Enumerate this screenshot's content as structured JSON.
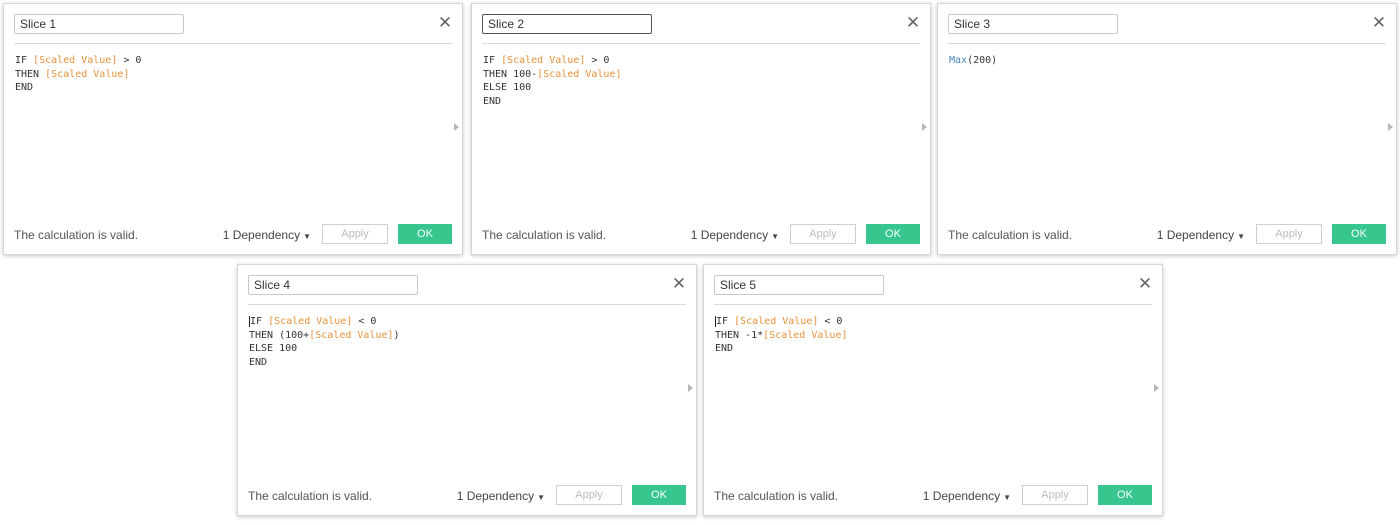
{
  "colors": {
    "ok_button": "#37c68d",
    "field_reference": "#e8913b",
    "function_name": "#4a84b8"
  },
  "icons": {
    "close": "close-icon",
    "dropdown": "caret-down-icon",
    "expand": "triangle-right-icon"
  },
  "dialogs": [
    {
      "name": "Slice 1",
      "focused": false,
      "formula": [
        [
          {
            "t": "IF ",
            "c": "kw"
          },
          {
            "t": "[Scaled Value]",
            "c": "field"
          },
          {
            "t": " > 0",
            "c": "kw"
          }
        ],
        [
          {
            "t": "THEN ",
            "c": "kw"
          },
          {
            "t": "[Scaled Value]",
            "c": "field"
          }
        ],
        [
          {
            "t": "END",
            "c": "kw"
          }
        ]
      ],
      "status": "The calculation is valid.",
      "dependency": "1 Dependency",
      "apply": "Apply",
      "ok": "OK"
    },
    {
      "name": "Slice 2",
      "focused": true,
      "formula": [
        [
          {
            "t": "IF ",
            "c": "kw"
          },
          {
            "t": "[Scaled Value]",
            "c": "field"
          },
          {
            "t": " > 0",
            "c": "kw"
          }
        ],
        [
          {
            "t": "THEN 100-",
            "c": "kw"
          },
          {
            "t": "[Scaled Value]",
            "c": "field"
          }
        ],
        [
          {
            "t": "ELSE 100",
            "c": "kw"
          }
        ],
        [
          {
            "t": "END",
            "c": "kw"
          }
        ]
      ],
      "status": "The calculation is valid.",
      "dependency": "1 Dependency",
      "apply": "Apply",
      "ok": "OK"
    },
    {
      "name": "Slice 3",
      "focused": false,
      "formula": [
        [
          {
            "t": "Max",
            "c": "fn"
          },
          {
            "t": "(200)",
            "c": "kw"
          }
        ]
      ],
      "status": "The calculation is valid.",
      "dependency": "1 Dependency",
      "apply": "Apply",
      "ok": "OK"
    },
    {
      "name": "Slice 4",
      "focused": false,
      "formula": [
        [
          {
            "t": "I",
            "c": "kw caret"
          },
          {
            "t": "F ",
            "c": "kw"
          },
          {
            "t": "[Scaled Value]",
            "c": "field"
          },
          {
            "t": " < 0",
            "c": "kw"
          }
        ],
        [
          {
            "t": "THEN (100+",
            "c": "kw"
          },
          {
            "t": "[Scaled Value]",
            "c": "field"
          },
          {
            "t": ")",
            "c": "kw"
          }
        ],
        [
          {
            "t": "ELSE 100",
            "c": "kw"
          }
        ],
        [
          {
            "t": "END",
            "c": "kw"
          }
        ]
      ],
      "status": "The calculation is valid.",
      "dependency": "1 Dependency",
      "apply": "Apply",
      "ok": "OK"
    },
    {
      "name": "Slice 5",
      "focused": false,
      "formula": [
        [
          {
            "t": "I",
            "c": "kw caret"
          },
          {
            "t": "F ",
            "c": "kw"
          },
          {
            "t": "[Scaled Value]",
            "c": "field"
          },
          {
            "t": " < 0",
            "c": "kw"
          }
        ],
        [
          {
            "t": "THEN -1*",
            "c": "kw"
          },
          {
            "t": "[Scaled Value]",
            "c": "field"
          }
        ],
        [
          {
            "t": "END",
            "c": "kw"
          }
        ]
      ],
      "status": "The calculation is valid.",
      "dependency": "1 Dependency",
      "apply": "Apply",
      "ok": "OK"
    }
  ]
}
